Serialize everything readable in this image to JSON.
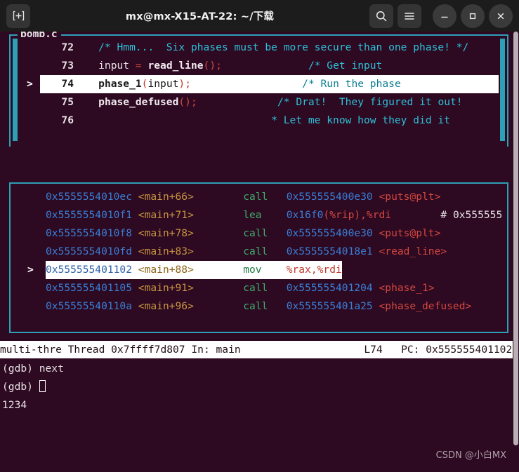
{
  "window": {
    "title": "mx@mx-X15-AT-22: ~/下载",
    "titlebar": {
      "new_tab_label": "+",
      "search_label": "search-icon",
      "menu_label": "menu-icon",
      "minimize_label": "–",
      "maximize_label": "□",
      "close_label": "✕"
    }
  },
  "colors": {
    "terminal_bg": "#2d0922",
    "pane_border": "#2ea0b6",
    "highlight_bg": "#ffffff",
    "comment": "#2fc0d6",
    "address": "#3a7fd5",
    "mnemonic": "#3fae6a",
    "symbol": "#d4483f",
    "offset": "#c8953f",
    "titlebar_bg": "#1c1c1c"
  },
  "source_pane": {
    "title": "bomb.c",
    "rows": [
      {
        "marker": "",
        "lineno": "72",
        "highlight": false,
        "tokens": [
          {
            "t": "    ",
            "c": "plain"
          },
          {
            "t": "/* Hmm...  Six phases must be more secure than one phase! */",
            "c": "comment"
          }
        ]
      },
      {
        "marker": "",
        "lineno": "73",
        "highlight": false,
        "tokens": [
          {
            "t": "    input ",
            "c": "plain"
          },
          {
            "t": "=",
            "c": "punct"
          },
          {
            "t": " ",
            "c": "plain"
          },
          {
            "t": "read_line",
            "c": "ident"
          },
          {
            "t": "()",
            "c": "punct"
          },
          {
            "t": ";",
            "c": "punct"
          },
          {
            "t": "              ",
            "c": "plain"
          },
          {
            "t": "/* Get input",
            "c": "comment"
          }
        ]
      },
      {
        "marker": ">",
        "lineno": "74",
        "highlight": true,
        "tokens": [
          {
            "t": "    ",
            "c": "plain"
          },
          {
            "t": "phase_1",
            "c": "ident"
          },
          {
            "t": "(",
            "c": "punct"
          },
          {
            "t": "input",
            "c": "plain"
          },
          {
            "t": ")",
            "c": "punct"
          },
          {
            "t": ";",
            "c": "punct"
          },
          {
            "t": "                  ",
            "c": "plain"
          },
          {
            "t": "/* Run the phase                 ",
            "c": "comment"
          }
        ]
      },
      {
        "marker": "",
        "lineno": "75",
        "highlight": false,
        "tokens": [
          {
            "t": "    ",
            "c": "plain"
          },
          {
            "t": "phase_defused",
            "c": "ident"
          },
          {
            "t": "()",
            "c": "punct"
          },
          {
            "t": ";",
            "c": "punct"
          },
          {
            "t": "             ",
            "c": "plain"
          },
          {
            "t": "/* Drat!  They figured it out!",
            "c": "comment"
          }
        ]
      },
      {
        "marker": "",
        "lineno": "76",
        "highlight": false,
        "tokens": [
          {
            "t": "                                ",
            "c": "plain"
          },
          {
            "t": "* Let me know how they did it",
            "c": "comment"
          }
        ]
      }
    ]
  },
  "asm_pane": {
    "rows": [
      {
        "marker": "",
        "highlight": false,
        "tokens": [
          {
            "t": "0x5555554010ec ",
            "c": "addr"
          },
          {
            "t": "<main",
            "c": "sym"
          },
          {
            "t": "+66>",
            "c": "sym"
          },
          {
            "t": "        ",
            "c": "plain"
          },
          {
            "t": "call",
            "c": "mnem"
          },
          {
            "t": "   ",
            "c": "plain"
          },
          {
            "t": "0x555555400e30 ",
            "c": "addr"
          },
          {
            "t": "<puts@plt>",
            "c": "symname"
          }
        ]
      },
      {
        "marker": "",
        "highlight": false,
        "tokens": [
          {
            "t": "0x5555554010f1 ",
            "c": "addr"
          },
          {
            "t": "<main",
            "c": "sym"
          },
          {
            "t": "+71>",
            "c": "sym"
          },
          {
            "t": "        ",
            "c": "plain"
          },
          {
            "t": "lea",
            "c": "mnem"
          },
          {
            "t": "    ",
            "c": "plain"
          },
          {
            "t": "0x16f0",
            "c": "addr"
          },
          {
            "t": "(%rip)",
            "c": "reg"
          },
          {
            "t": ",%rdi",
            "c": "reg"
          },
          {
            "t": "        ",
            "c": "plain"
          },
          {
            "t": "# 0x555555",
            "c": "plain"
          }
        ]
      },
      {
        "marker": "",
        "highlight": false,
        "tokens": [
          {
            "t": "0x5555554010f8 ",
            "c": "addr"
          },
          {
            "t": "<main",
            "c": "sym"
          },
          {
            "t": "+78>",
            "c": "sym"
          },
          {
            "t": "        ",
            "c": "plain"
          },
          {
            "t": "call",
            "c": "mnem"
          },
          {
            "t": "   ",
            "c": "plain"
          },
          {
            "t": "0x555555400e30 ",
            "c": "addr"
          },
          {
            "t": "<puts@plt>",
            "c": "symname"
          }
        ]
      },
      {
        "marker": "",
        "highlight": false,
        "tokens": [
          {
            "t": "0x5555554010fd ",
            "c": "addr"
          },
          {
            "t": "<main",
            "c": "sym"
          },
          {
            "t": "+83>",
            "c": "sym"
          },
          {
            "t": "        ",
            "c": "plain"
          },
          {
            "t": "call",
            "c": "mnem"
          },
          {
            "t": "   ",
            "c": "plain"
          },
          {
            "t": "0x5555554018e1 ",
            "c": "addr"
          },
          {
            "t": "<read_line>",
            "c": "symname"
          }
        ]
      },
      {
        "marker": ">",
        "highlight": true,
        "tokens": [
          {
            "t": "0x555555401102 ",
            "c": "addr"
          },
          {
            "t": "<main",
            "c": "sym"
          },
          {
            "t": "+88>",
            "c": "sym"
          },
          {
            "t": "        ",
            "c": "plain"
          },
          {
            "t": "mov",
            "c": "mnem"
          },
          {
            "t": "    ",
            "c": "plain"
          },
          {
            "t": "%rax,%rdi",
            "c": "reg"
          }
        ]
      },
      {
        "marker": "",
        "highlight": false,
        "tokens": [
          {
            "t": "0x555555401105 ",
            "c": "addr"
          },
          {
            "t": "<main",
            "c": "sym"
          },
          {
            "t": "+91>",
            "c": "sym"
          },
          {
            "t": "        ",
            "c": "plain"
          },
          {
            "t": "call",
            "c": "mnem"
          },
          {
            "t": "   ",
            "c": "plain"
          },
          {
            "t": "0x555555401204 ",
            "c": "addr"
          },
          {
            "t": "<phase_1>",
            "c": "symname"
          }
        ]
      },
      {
        "marker": "",
        "highlight": false,
        "tokens": [
          {
            "t": "0x55555540110a ",
            "c": "addr"
          },
          {
            "t": "<main",
            "c": "sym"
          },
          {
            "t": "+96>",
            "c": "sym"
          },
          {
            "t": "        ",
            "c": "plain"
          },
          {
            "t": "call",
            "c": "mnem"
          },
          {
            "t": "   ",
            "c": "plain"
          },
          {
            "t": "0x555555401a25 ",
            "c": "addr"
          },
          {
            "t": "<phase_defused>",
            "c": "symname"
          }
        ]
      }
    ]
  },
  "status_bar": {
    "text": "multi-thre Thread 0x7ffff7d807 In: main                    L74   PC: 0x555555401102",
    "process": "multi-thre",
    "thread": "Thread 0x7ffff7d807",
    "frame": "In: main",
    "line": "L74",
    "pc": "PC: 0x555555401102"
  },
  "command_area": {
    "lines": [
      {
        "prompt": "(gdb) ",
        "text": "next",
        "cursor": false
      },
      {
        "prompt": "(gdb) ",
        "text": "",
        "cursor": true
      },
      {
        "prompt": "",
        "text": "1234",
        "cursor": false
      }
    ]
  },
  "watermark": {
    "text": "CSDN @小白MX"
  }
}
